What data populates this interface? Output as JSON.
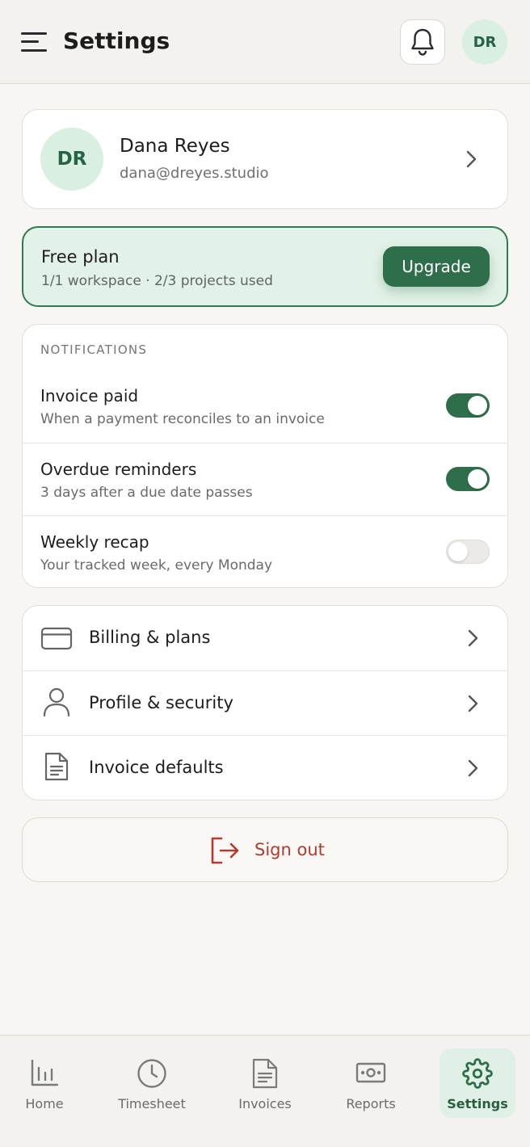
{
  "header": {
    "title": "Settings",
    "avatar_initials": "DR"
  },
  "profile": {
    "initials": "DR",
    "name": "Dana Reyes",
    "email": "dana@dreyes.studio"
  },
  "plan": {
    "title": "Free plan",
    "usage": "1/1 workspace · 2/3 projects used",
    "upgrade_label": "Upgrade"
  },
  "notifications": {
    "section_label": "NOTIFICATIONS",
    "items": [
      {
        "title": "Invoice paid",
        "description": "When a payment reconciles to an invoice",
        "enabled": true
      },
      {
        "title": "Overdue reminders",
        "description": "3 days after a due date passes",
        "enabled": true
      },
      {
        "title": "Weekly recap",
        "description": "Your tracked week, every Monday",
        "enabled": false
      }
    ]
  },
  "links": [
    {
      "label": "Billing & plans",
      "icon": "credit-card-icon"
    },
    {
      "label": "Profile & security",
      "icon": "user-icon"
    },
    {
      "label": "Invoice defaults",
      "icon": "document-icon"
    }
  ],
  "sign_out": {
    "label": "Sign out",
    "icon": "logout-icon"
  },
  "bottom_nav": {
    "active": "Settings",
    "items": [
      {
        "label": "Home",
        "icon": "bar-chart-icon"
      },
      {
        "label": "Timesheet",
        "icon": "clock-icon"
      },
      {
        "label": "Invoices",
        "icon": "document-icon"
      },
      {
        "label": "Reports",
        "icon": "banknote-icon"
      },
      {
        "label": "Settings",
        "icon": "gear-icon"
      }
    ]
  },
  "colors": {
    "brand_green": "#2f6e4a",
    "accent_light_green": "#e3f2e8",
    "danger_red": "#b13b30",
    "background": "#f7f6f3"
  }
}
